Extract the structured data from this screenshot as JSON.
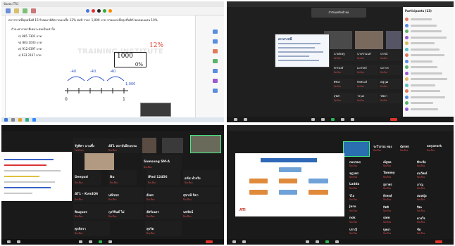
{
  "quad1": {
    "window_title": "ข้อสอบ TR1",
    "question": "ตราสารหนี้ชุดหนึ่งมี 15 ปี ต่อมามีอัตราดอกเบี้ย 12% ต่อปี ราคา 1,000 บาท จ่ายดอกเบี้ยทุกสิ้นปีถ้าผลตอบแทน 10%",
    "sub": "ถ้าจะหาราคาที่เหมาะสมเป็นเท่าใด",
    "choices": [
      "ก) 885.7302 บาท",
      "ข) 883.1043 บาท",
      "ค) 912.6397 บาท",
      "ง) 933.2167 บาท"
    ],
    "box_top": "1000",
    "box_bottom": "0%",
    "pct": "12%",
    "watermark": "TRAINING INSTITUTE",
    "axis_labels": [
      "0",
      "1"
    ],
    "arrow_labels": [
      "-40",
      "-40",
      "-40"
    ],
    "end_value": "1,000"
  },
  "quad2": {
    "share_banner": "กำลังแชร์หน้าจอ",
    "slide_title": "ตราสารหนี้",
    "chat_title": "Participants (23)",
    "participants": [
      {
        "name": "นายพิเชฐ",
        "status": "ปิดเสียง"
      },
      {
        "name": "นายชานนท์",
        "status": "ปิดเสียง"
      },
      {
        "name": "ปกรณ์",
        "status": "ปิดเสียง"
      },
      {
        "name": "จักรพงษ์",
        "status": "ปิดเสียง"
      },
      {
        "name": "มะลิวัลย์",
        "status": "ปิดเสียง"
      },
      {
        "name": "นภาพร",
        "status": "ปิดเสียง"
      },
      {
        "name": "ศิริพร",
        "status": "ปิดเสียง"
      },
      {
        "name": "กิตติพงษ์",
        "status": "ปิดเสียง"
      },
      {
        "name": "ณัฐวุฒิ",
        "status": "ปิดเสียง"
      },
      {
        "name": "สุนิสา",
        "status": "ปิดเสียง"
      },
      {
        "name": "วรวุฒิ",
        "status": "ปิดเสียง"
      },
      {
        "name": "ชนิดา",
        "status": "ปิดเสียง"
      }
    ]
  },
  "quad3": {
    "gallery": [
      {
        "name": "รัฐพิศา นานพึ่ง",
        "status": "ไม่พร้อม"
      },
      {
        "name": "AT1 สถาบันฝึกอบรม",
        "status": "ปิดเสียง"
      },
      {
        "name": "Samsung SM-A",
        "status": "ปิดเสียง"
      },
      {
        "name": "Deepad",
        "status": "ปิดเสียง"
      },
      {
        "name": "Bu",
        "status": "ปิดเสียง"
      },
      {
        "name": "iPad 12456",
        "status": "ปิดเสียง"
      },
      {
        "name": "ธนัช ทำจริง",
        "status": "ปิดเสียง"
      },
      {
        "name": "AT1 - Kvn4Q6",
        "status": "ปิดเสียง"
      },
      {
        "name": "ปณิชชา",
        "status": "ปิดเสียง"
      },
      {
        "name": "ยังพร",
        "status": "ปิดเสียง"
      },
      {
        "name": "สุชาณี จิดา",
        "status": "ปิดเสียง"
      },
      {
        "name": "พิณยุนทร",
        "status": "ปิดเสียง"
      },
      {
        "name": "กุลริจินต์ ไผ่",
        "status": "ปิดเสียง"
      },
      {
        "name": "อัศวิเนตร",
        "status": "ปิดเสียง"
      },
      {
        "name": "นพรัตน์",
        "status": "ปิดเสียง"
      },
      {
        "name": "ศุภจิตรา",
        "status": "ปิดเสียง"
      },
      {
        "name": "สุจริต",
        "status": "ปิดเสียง"
      }
    ]
  },
  "quad4": {
    "slide_logo": "ATI",
    "gallery": [
      {
        "name": "ระวีวรรณ ทอง",
        "status": "ปิดเสียง"
      },
      {
        "name": "ฉัตรพร",
        "status": "ปิดเสียง"
      },
      {
        "name": "anyarark",
        "status": "ปิดเสียง"
      },
      {
        "name": "กมลชนก",
        "status": "ปิดเสียง"
      },
      {
        "name": "ณัฐพล",
        "status": "ปิดเสียง"
      },
      {
        "name": "พีระชัย",
        "status": "ปิดเสียง"
      },
      {
        "name": "ชฎาพร",
        "status": "ปิดเสียง"
      },
      {
        "name": "Tammy",
        "status": "ปิดเสียง"
      },
      {
        "name": "ธนวัฒน์",
        "status": "ปิดเสียง"
      },
      {
        "name": "Ladda",
        "status": "ปิดเสียง"
      },
      {
        "name": "สุภาพร",
        "status": "ปิดเสียง"
      },
      {
        "name": "ภาณุ",
        "status": "ปิดเสียง"
      },
      {
        "name": "วิไล",
        "status": "ปิดเสียง"
      },
      {
        "name": "ธีรพงษ์",
        "status": "ปิดเสียง"
      },
      {
        "name": "สมหญิง",
        "status": "ปิดเสียง"
      },
      {
        "name": "Jaru",
        "status": "ปิดเสียง"
      },
      {
        "name": "กิตติ",
        "status": "ปิดเสียง"
      },
      {
        "name": "ปิยะ",
        "status": "ปิดเสียง"
      },
      {
        "name": "nok",
        "status": "ปิดเสียง"
      },
      {
        "name": "sam",
        "status": "ปิดเสียง"
      },
      {
        "name": "ดวงใจ",
        "status": "ปิดเสียง"
      },
      {
        "name": "ปราณี",
        "status": "ปิดเสียง"
      },
      {
        "name": "บุษบา",
        "status": "ปิดเสียง"
      },
      {
        "name": "ชัย",
        "status": "ปิดเสียง"
      }
    ]
  },
  "colors": {
    "accent_red": "#d23c2c",
    "zoom_dark": "#1a1a1a",
    "leave_red": "#d9342b",
    "active_green": "#2fb552"
  }
}
